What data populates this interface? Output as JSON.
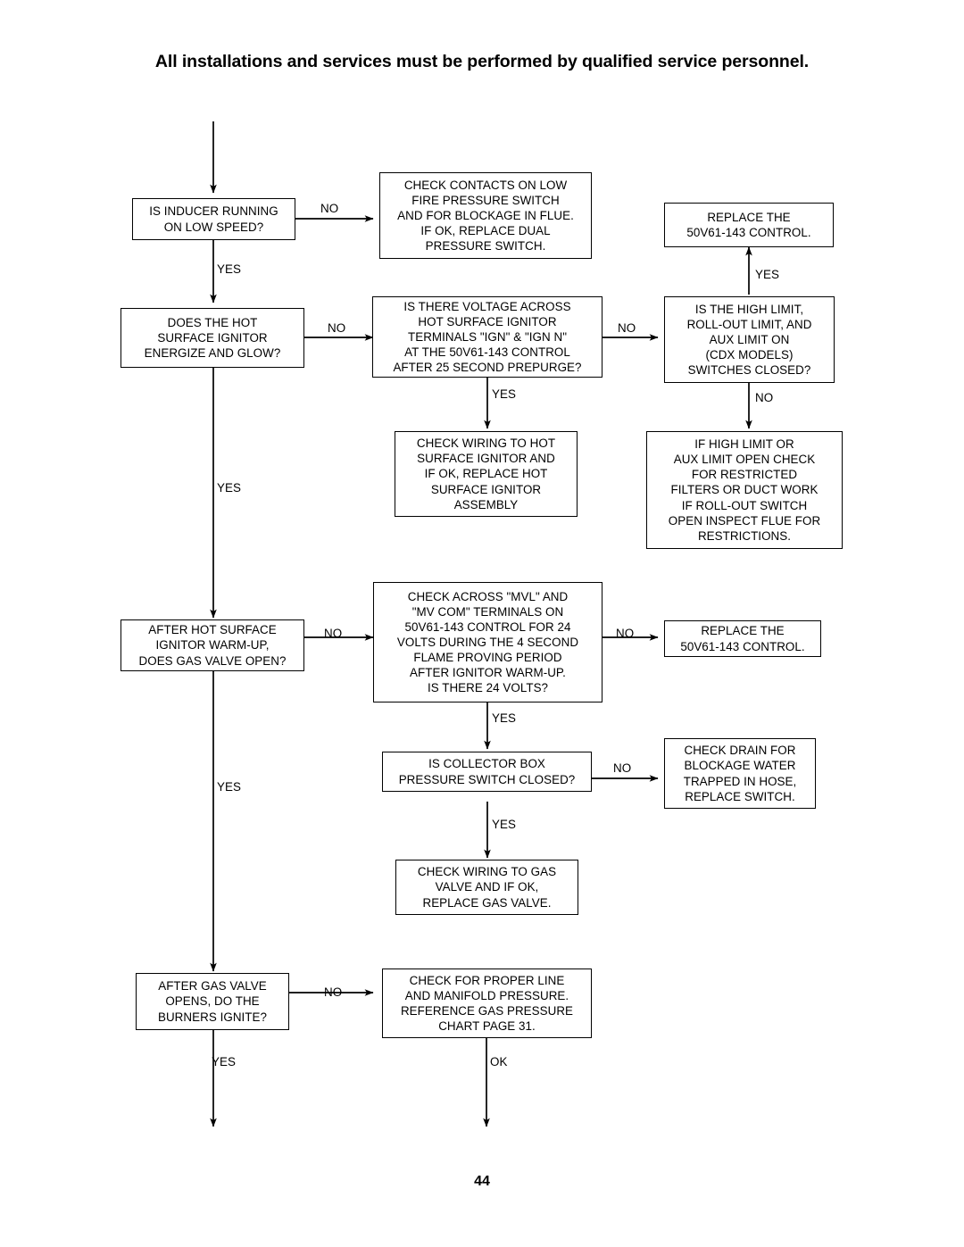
{
  "page": {
    "title": "All installations and services must be performed by qualified service personnel.",
    "number": "44"
  },
  "flowchart": {
    "type": "troubleshooting-flowchart",
    "nodes": [
      {
        "id": "n1",
        "text": "IS INDUCER RUNNING\nON LOW SPEED?",
        "kind": "decision"
      },
      {
        "id": "n2",
        "text": "CHECK CONTACTS ON LOW\nFIRE PRESSURE SWITCH\nAND FOR BLOCKAGE IN FLUE.\nIF OK, REPLACE DUAL\nPRESSURE SWITCH.",
        "kind": "action"
      },
      {
        "id": "n3",
        "text": "REPLACE THE\n50V61-143 CONTROL.",
        "kind": "action"
      },
      {
        "id": "n4",
        "text": "DOES THE HOT\nSURFACE IGNITOR\nENERGIZE AND GLOW?",
        "kind": "decision"
      },
      {
        "id": "n5",
        "text": "IS THERE VOLTAGE ACROSS\nHOT SURFACE IGNITOR\nTERMINALS \"IGN\" & \"IGN N\"\nAT THE 50V61-143 CONTROL\nAFTER 25 SECOND PREPURGE?",
        "kind": "decision"
      },
      {
        "id": "n6",
        "text": "IS THE HIGH LIMIT,\nROLL-OUT LIMIT, AND\nAUX LIMIT ON\n(CDX MODELS)\nSWITCHES CLOSED?",
        "kind": "decision"
      },
      {
        "id": "n7",
        "text": "CHECK WIRING TO HOT\nSURFACE IGNITOR AND\nIF OK, REPLACE HOT\nSURFACE IGNITOR\nASSEMBLY",
        "kind": "action"
      },
      {
        "id": "n8",
        "text": "IF HIGH LIMIT OR\nAUX LIMIT OPEN CHECK\nFOR RESTRICTED\nFILTERS OR DUCT WORK\nIF ROLL-OUT SWITCH\nOPEN INSPECT FLUE FOR\nRESTRICTIONS.",
        "kind": "action"
      },
      {
        "id": "n9",
        "text": "AFTER HOT SURFACE\nIGNITOR WARM-UP,\nDOES GAS VALVE OPEN?",
        "kind": "decision"
      },
      {
        "id": "n10",
        "text": "CHECK ACROSS \"MVL\" AND\n\"MV COM\" TERMINALS ON\n50V61-143 CONTROL FOR 24\nVOLTS DURING THE 4 SECOND\nFLAME PROVING PERIOD\nAFTER IGNITOR WARM-UP.\nIS THERE 24 VOLTS?",
        "kind": "decision"
      },
      {
        "id": "n11",
        "text": "REPLACE THE\n50V61-143 CONTROL.",
        "kind": "action"
      },
      {
        "id": "n12",
        "text": "IS COLLECTOR BOX\nPRESSURE SWITCH CLOSED?",
        "kind": "decision"
      },
      {
        "id": "n13",
        "text": "CHECK DRAIN FOR\nBLOCKAGE WATER\nTRAPPED IN HOSE,\nREPLACE SWITCH.",
        "kind": "action"
      },
      {
        "id": "n14",
        "text": "CHECK WIRING TO GAS\nVALVE AND IF OK,\nREPLACE GAS VALVE.",
        "kind": "action"
      },
      {
        "id": "n15",
        "text": "AFTER GAS VALVE\nOPENS, DO THE\nBURNERS IGNITE?",
        "kind": "decision"
      },
      {
        "id": "n16",
        "text": "CHECK FOR PROPER LINE\nAND MANIFOLD PRESSURE.\nREFERENCE GAS PRESSURE\nCHART PAGE 31.",
        "kind": "action"
      }
    ],
    "edge_labels": [
      {
        "id": "e1",
        "text": "NO"
      },
      {
        "id": "e2",
        "text": "YES"
      },
      {
        "id": "e3",
        "text": "YES"
      },
      {
        "id": "e4",
        "text": "NO"
      },
      {
        "id": "e5",
        "text": "NO"
      },
      {
        "id": "e6",
        "text": "YES"
      },
      {
        "id": "e7",
        "text": "NO"
      },
      {
        "id": "e8",
        "text": "YES"
      },
      {
        "id": "e9",
        "text": "NO"
      },
      {
        "id": "e10",
        "text": "NO"
      },
      {
        "id": "e11",
        "text": "YES"
      },
      {
        "id": "e12",
        "text": "NO"
      },
      {
        "id": "e13",
        "text": "YES"
      },
      {
        "id": "e14",
        "text": "YES"
      },
      {
        "id": "e15",
        "text": "NO"
      },
      {
        "id": "e16",
        "text": "YES"
      },
      {
        "id": "e17",
        "text": "OK"
      }
    ],
    "colors": {
      "line": "#000000",
      "box_border": "#000000",
      "background": "#ffffff"
    }
  }
}
